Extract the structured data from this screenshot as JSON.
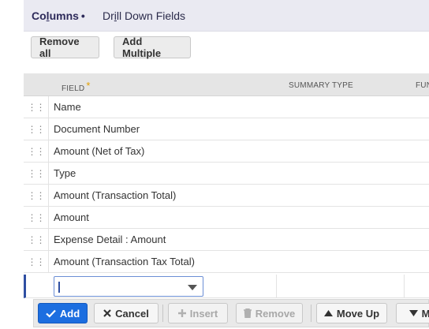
{
  "tabs": {
    "columns_prefix": "Co",
    "columns_underlined": "l",
    "columns_suffix": "umns",
    "columns_dot": "•",
    "drill_prefix": "Dr",
    "drill_underlined": "i",
    "drill_suffix": "ll Down Fields"
  },
  "toolbar": {
    "remove_all": "Remove all",
    "add_multiple": "Add Multiple"
  },
  "table": {
    "headers": {
      "field": "FIELD",
      "field_required": "*",
      "summary_type": "SUMMARY TYPE",
      "function": "FUN"
    },
    "rows": [
      {
        "field": "Name"
      },
      {
        "field": "Document Number"
      },
      {
        "field": "Amount (Net of Tax)"
      },
      {
        "field": "Type"
      },
      {
        "field": "Amount (Transaction Total)"
      },
      {
        "field": "Amount"
      },
      {
        "field": "Expense Detail : Amount"
      },
      {
        "field": "Amount (Transaction Tax Total)"
      }
    ],
    "handle_glyph": "⋮⋮"
  },
  "edit_row": {
    "select_value": ""
  },
  "actions": {
    "add": "Add",
    "cancel": "Cancel",
    "insert": "Insert",
    "remove": "Remove",
    "move_up": "Move Up",
    "more": "M"
  },
  "icons": {
    "add": "check-icon",
    "cancel": "x-icon",
    "insert": "plus-icon",
    "remove": "trash-icon",
    "move_up": "triangle-up-icon",
    "more": "triangle-down-icon"
  },
  "colors": {
    "accent": "#1c6ee0",
    "tabbar": "#eaeaf2",
    "required": "#e39f00",
    "edit_border": "#2f4fa2"
  }
}
